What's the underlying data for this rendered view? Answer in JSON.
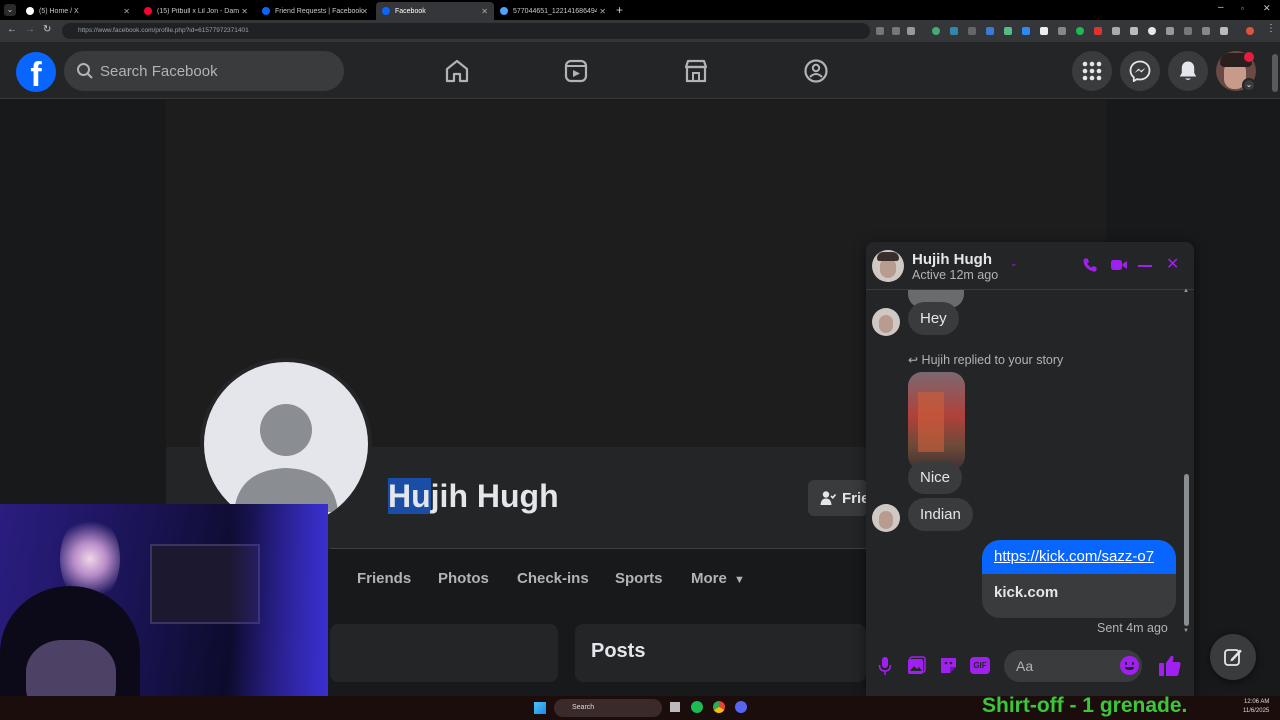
{
  "browser": {
    "tabs": [
      {
        "label": "(5) Home / X"
      },
      {
        "label": "(15) Pitbull x Lil Jon - Damn I Lo"
      },
      {
        "label": "Friend Requests | Facebook"
      },
      {
        "label": "Facebook"
      },
      {
        "label": "577044651_122141686494093411"
      }
    ],
    "new_tab": "+",
    "url": "https://www.facebook.com/profile.php?id=61577972371401"
  },
  "header": {
    "logo": "f",
    "search_placeholder": "Search Facebook"
  },
  "profile": {
    "name_selected": "Hu",
    "name_rest": "jih Hugh",
    "friends_button": "Frie",
    "tabs": [
      "Friends",
      "Photos",
      "Check-ins",
      "Sports",
      "More"
    ],
    "posts_title": "Posts"
  },
  "chat": {
    "name": "Hujih Hugh",
    "status": "Active 12m ago",
    "messages": {
      "hey": "Hey",
      "story_note": "Hujih replied to your story",
      "nice": "Nice",
      "indian": "Indian",
      "link": "https://kick.com/sazz-o7",
      "link_preview": "kick.com",
      "sent": "Sent 4m ago"
    },
    "input_placeholder": "Aa"
  },
  "taskbar": {
    "search": "Search",
    "time": "12:06 AM",
    "date": "11/6/2025"
  },
  "overlay_text": "Shirt-off -   1 grenade.",
  "colors": {
    "facebook_blue": "#0866ff",
    "chat_accent": "#a020f0",
    "sent_bubble": "#0866ff",
    "overlay_green": "#3ac83a"
  }
}
